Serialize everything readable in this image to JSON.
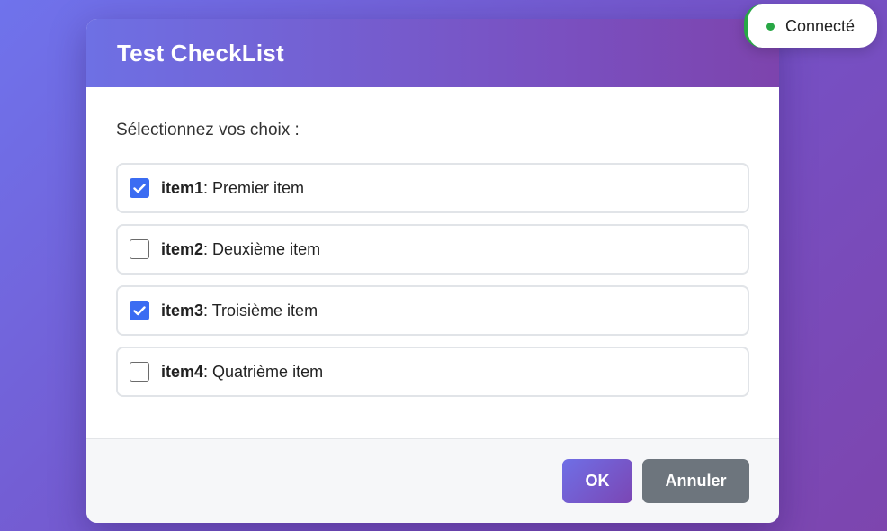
{
  "dialog": {
    "title": "Test CheckList",
    "prompt": "Sélectionnez vos choix :",
    "options": [
      {
        "key": "item1",
        "label": ": Premier item",
        "checked": true
      },
      {
        "key": "item2",
        "label": ": Deuxième item",
        "checked": false
      },
      {
        "key": "item3",
        "label": ": Troisième item",
        "checked": true
      },
      {
        "key": "item4",
        "label": ": Quatrième item",
        "checked": false
      }
    ],
    "buttons": {
      "ok_label": "OK",
      "cancel_label": "Annuler"
    }
  },
  "status": {
    "text": "Connecté",
    "color": "#28a745"
  },
  "colors": {
    "accent": "#3b6cf2",
    "header_gradient_start": "#6e70e4",
    "header_gradient_end": "#7d44ad",
    "cancel_button": "#6d757d"
  }
}
